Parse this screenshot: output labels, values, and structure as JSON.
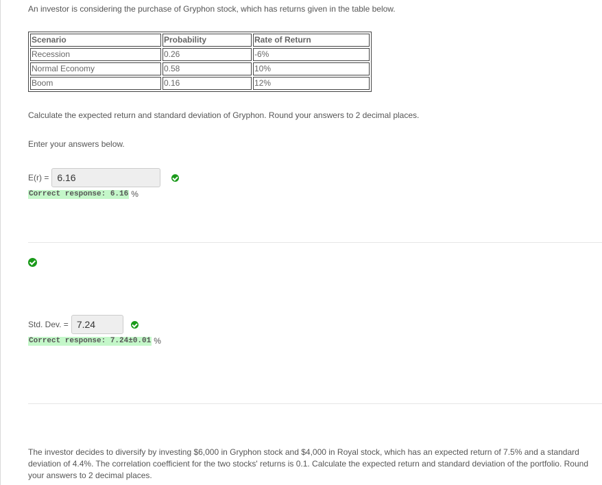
{
  "intro": "An investor is considering the purchase of Gryphon stock, which has returns given in the table below.",
  "table": {
    "headers": [
      "Scenario",
      "Probability",
      "Rate of Return"
    ],
    "rows": [
      [
        "Recession",
        "0.26",
        "-6%"
      ],
      [
        "Normal Economy",
        "0.58",
        "10%"
      ],
      [
        "Boom",
        "0.16",
        "12%"
      ]
    ]
  },
  "instructions": "Calculate the expected return and standard deviation of Gryphon. Round your answers to 2 decimal places.",
  "enter_prompt": "Enter your answers below.",
  "expected_return": {
    "label": "E(r) =",
    "value": "6.16",
    "status_icon": "check-circle-icon",
    "correct_response": "Correct response: 6.16",
    "unit": "%"
  },
  "std_dev": {
    "label": "Std. Dev. =",
    "value": "7.24",
    "status_icon": "check-circle-icon",
    "correct_response": "Correct response: 7.24±0.01",
    "unit": "%"
  },
  "part_status_icon": "check-circle-icon",
  "colors": {
    "correct_green": "#1a9a1a",
    "correct_highlight": "#c4f7c9",
    "input_bg": "#eeeeee"
  },
  "diversify_text": "The investor decides to diversify by investing $6,000 in Gryphon stock and $4,000 in Royal stock, which has an expected return of 7.5% and a standard deviation of 4.4%. The correlation coefficient for the two stocks' returns is 0.1. Calculate the expected return and standard deviation of the portfolio. Round your answers to 2 decimal places."
}
